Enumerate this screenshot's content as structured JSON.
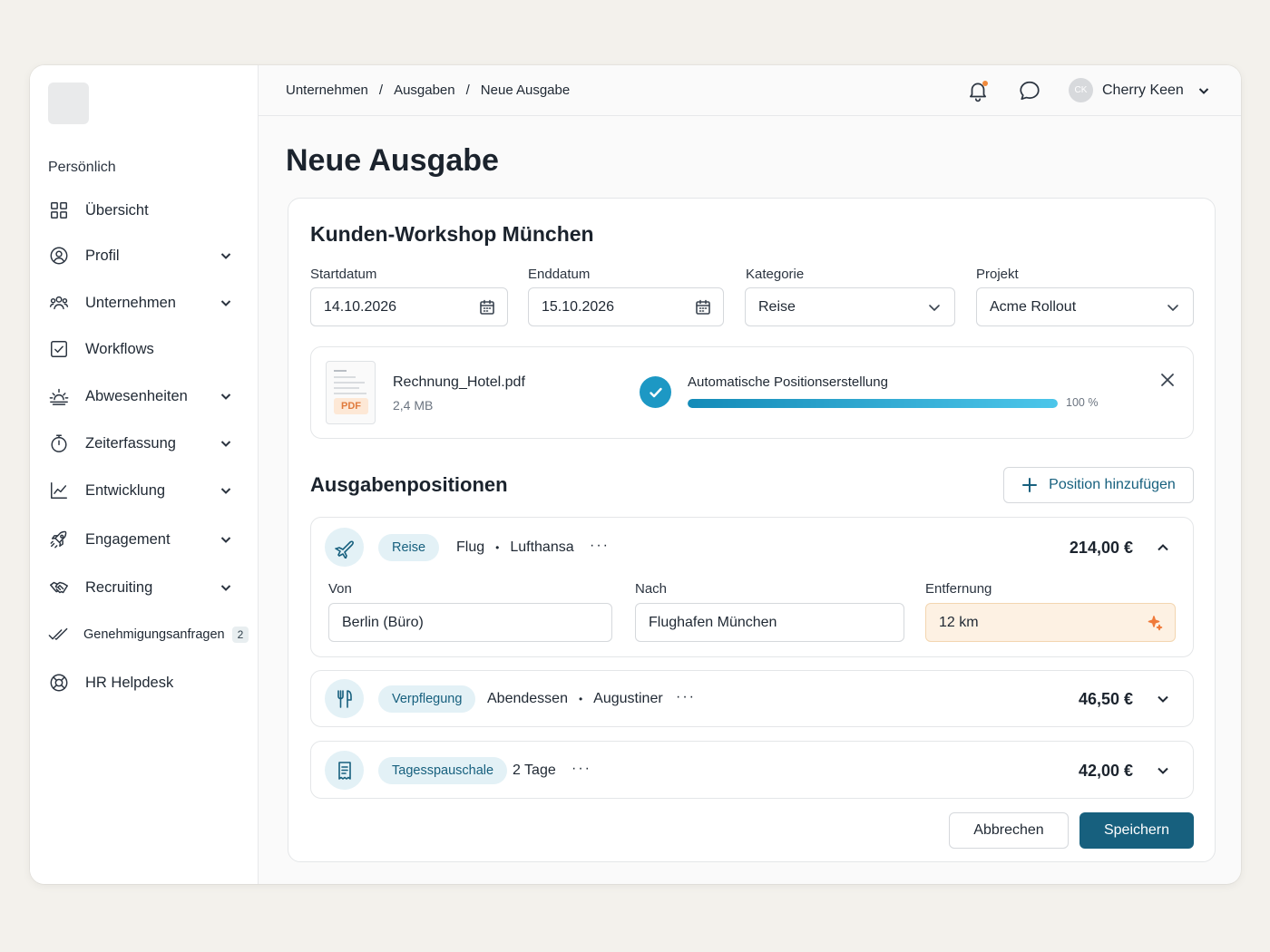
{
  "sidebar": {
    "section_label": "Persönlich",
    "items": [
      {
        "label": "Übersicht",
        "icon": "grid-icon",
        "has_chevron": false
      },
      {
        "label": "Profil",
        "icon": "user-circle-icon",
        "has_chevron": true
      },
      {
        "label": "Unternehmen",
        "icon": "users-icon",
        "has_chevron": true
      },
      {
        "label": "Workflows",
        "icon": "checkbox-icon",
        "has_chevron": false
      },
      {
        "label": "Abwesenheiten",
        "icon": "sunrise-icon",
        "has_chevron": true
      },
      {
        "label": "Zeiterfassung",
        "icon": "stopwatch-icon",
        "has_chevron": true
      },
      {
        "label": "Entwicklung",
        "icon": "chart-line-icon",
        "has_chevron": true
      },
      {
        "label": "Engagement",
        "icon": "rocket-icon",
        "has_chevron": true
      },
      {
        "label": "Recruiting",
        "icon": "handshake-icon",
        "has_chevron": true
      },
      {
        "label": "Genehmigungsanfragen",
        "icon": "double-check-icon",
        "has_chevron": false,
        "badge": "2"
      },
      {
        "label": "HR Helpdesk",
        "icon": "lifebuoy-icon",
        "has_chevron": false
      }
    ]
  },
  "header": {
    "breadcrumb": [
      "Unternehmen",
      "Ausgaben",
      "Neue Ausgabe"
    ],
    "breadcrumb_sep": "/",
    "user": {
      "initials": "CK",
      "name": "Cherry Keen"
    }
  },
  "page": {
    "title": "Neue Ausgabe"
  },
  "expense": {
    "title": "Kunden-Workshop München",
    "fields": {
      "start_label": "Startdatum",
      "start_value": "14.10.2026",
      "end_label": "Enddatum",
      "end_value": "15.10.2026",
      "category_label": "Kategorie",
      "category_value": "Reise",
      "project_label": "Projekt",
      "project_value": "Acme Rollout"
    },
    "upload": {
      "file_name": "Rechnung_Hotel.pdf",
      "file_size": "2,4 MB",
      "file_type": "PDF",
      "process_label": "Automatische Positionserstellung",
      "progress": 1.0,
      "progress_text": "100 %"
    },
    "positions_title": "Ausgabenpositionen",
    "add_position_label": "Position hinzufügen",
    "positions": [
      {
        "icon": "plane-icon",
        "category": "Reise",
        "type": "Flug",
        "vendor": "Lufthansa",
        "more": "···",
        "amount": "214,00 €",
        "expanded": true,
        "from_label": "Von",
        "from_value": "Berlin (Büro)",
        "to_label": "Nach",
        "to_value": "Flughafen München",
        "distance_label": "Entfernung",
        "distance_value": "12 km"
      },
      {
        "icon": "cutlery-icon",
        "category": "Verpflegung",
        "type": "Abendessen",
        "vendor": "Augustiner",
        "more": "···",
        "amount": "46,50 €",
        "expanded": false
      },
      {
        "icon": "receipt-icon",
        "category": "Tagesspauschale",
        "type": "2 Tage",
        "more": "···",
        "amount": "42,00 €",
        "expanded": false
      }
    ],
    "cancel_label": "Abbrechen",
    "save_label": "Speichern"
  },
  "colors": {
    "accent": "#17607e",
    "progress": "#1d98c4",
    "ai_field_bg": "#fdf1e3",
    "pdf_tag": "#e07a3c"
  }
}
